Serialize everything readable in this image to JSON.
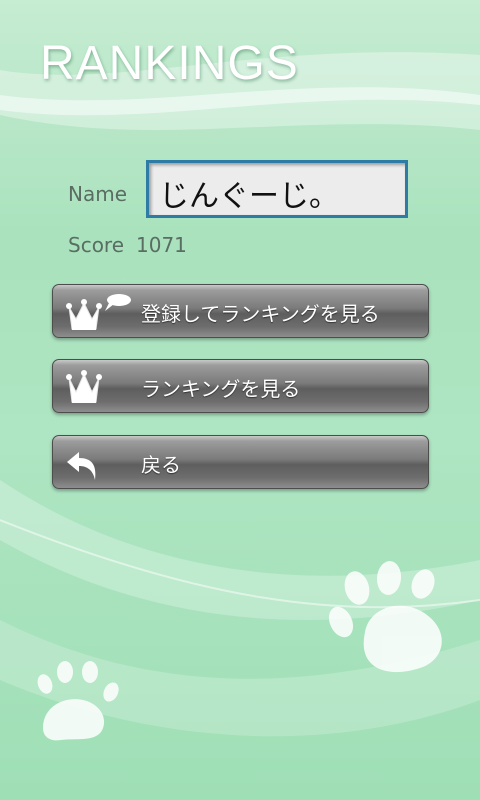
{
  "screen": {
    "title": "RANKINGS"
  },
  "form": {
    "name_label": "Name",
    "name_value": "じんぐーじ。",
    "score_label": "Score",
    "score_value": "1071"
  },
  "buttons": {
    "register_and_view": "登録してランキングを見る",
    "view_rankings": "ランキングを見る",
    "back": "戻る"
  },
  "icons": {
    "register": "crown-speech-bubble-icon",
    "view": "crown-icon",
    "back": "back-arrow-icon",
    "decoration": "paw-print-icon"
  },
  "colors": {
    "background": "#aee5c2",
    "input_border": "#2e7ca6",
    "button": "#6d6d6d",
    "text_muted": "#5a6d62"
  }
}
